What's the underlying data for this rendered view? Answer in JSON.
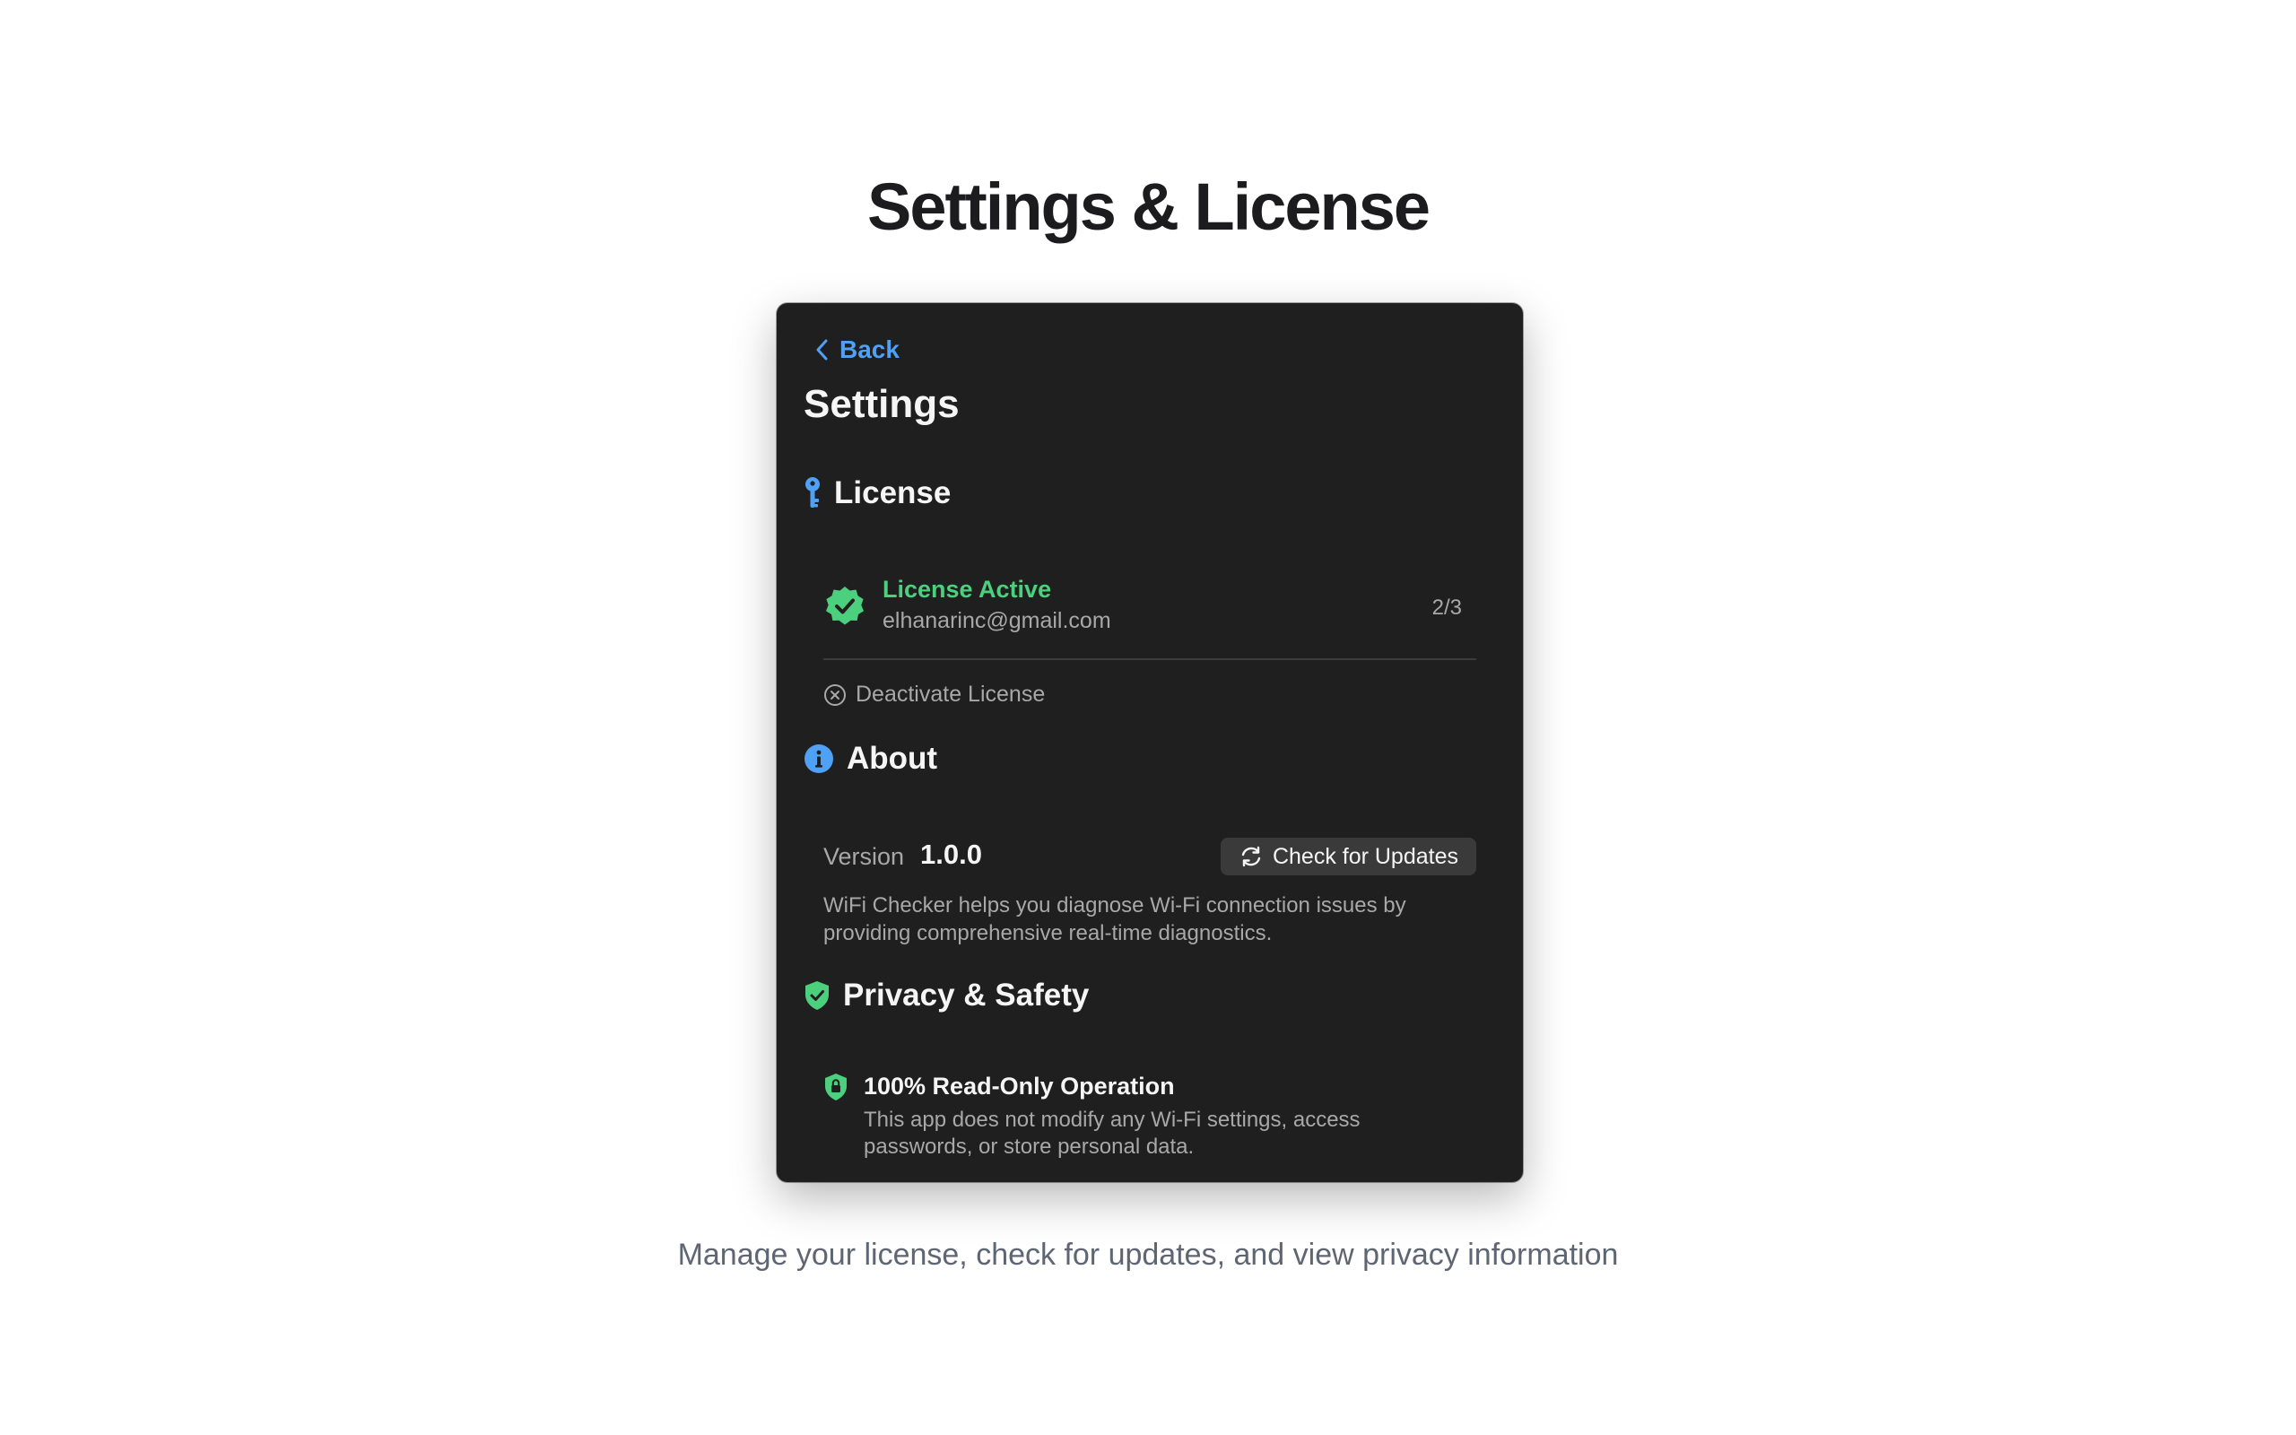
{
  "page": {
    "headline": "Settings & License",
    "caption": "Manage your license, check for updates, and view privacy information"
  },
  "window": {
    "back_label": "Back",
    "title": "Settings",
    "license": {
      "heading": "License",
      "status": "License Active",
      "email": "elhanarinc@gmail.com",
      "activations": "2/3",
      "deactivate_label": "Deactivate License"
    },
    "about": {
      "heading": "About",
      "version_label": "Version",
      "version_value": "1.0.0",
      "check_updates_label": "Check for Updates",
      "description": "WiFi Checker helps you diagnose Wi-Fi connection issues by providing comprehensive real-time diagnostics."
    },
    "privacy": {
      "heading": "Privacy & Safety",
      "item_title": "100% Read-Only Operation",
      "item_description": "This app does not modify any Wi-Fi settings, access passwords, or store personal data."
    }
  },
  "colors": {
    "accent_blue": "#4ea1f5",
    "success_green": "#4cd07d",
    "panel_bg": "#1f1f1f",
    "button_bg": "#3a3a3a"
  },
  "icons": {
    "back": "chevron-left-icon",
    "license": "key-icon",
    "license_status": "verified-badge-icon",
    "deactivate": "x-circle-icon",
    "about": "info-circle-icon",
    "update": "refresh-icon",
    "privacy": "shield-check-icon",
    "privacy_item": "lock-shield-icon"
  }
}
